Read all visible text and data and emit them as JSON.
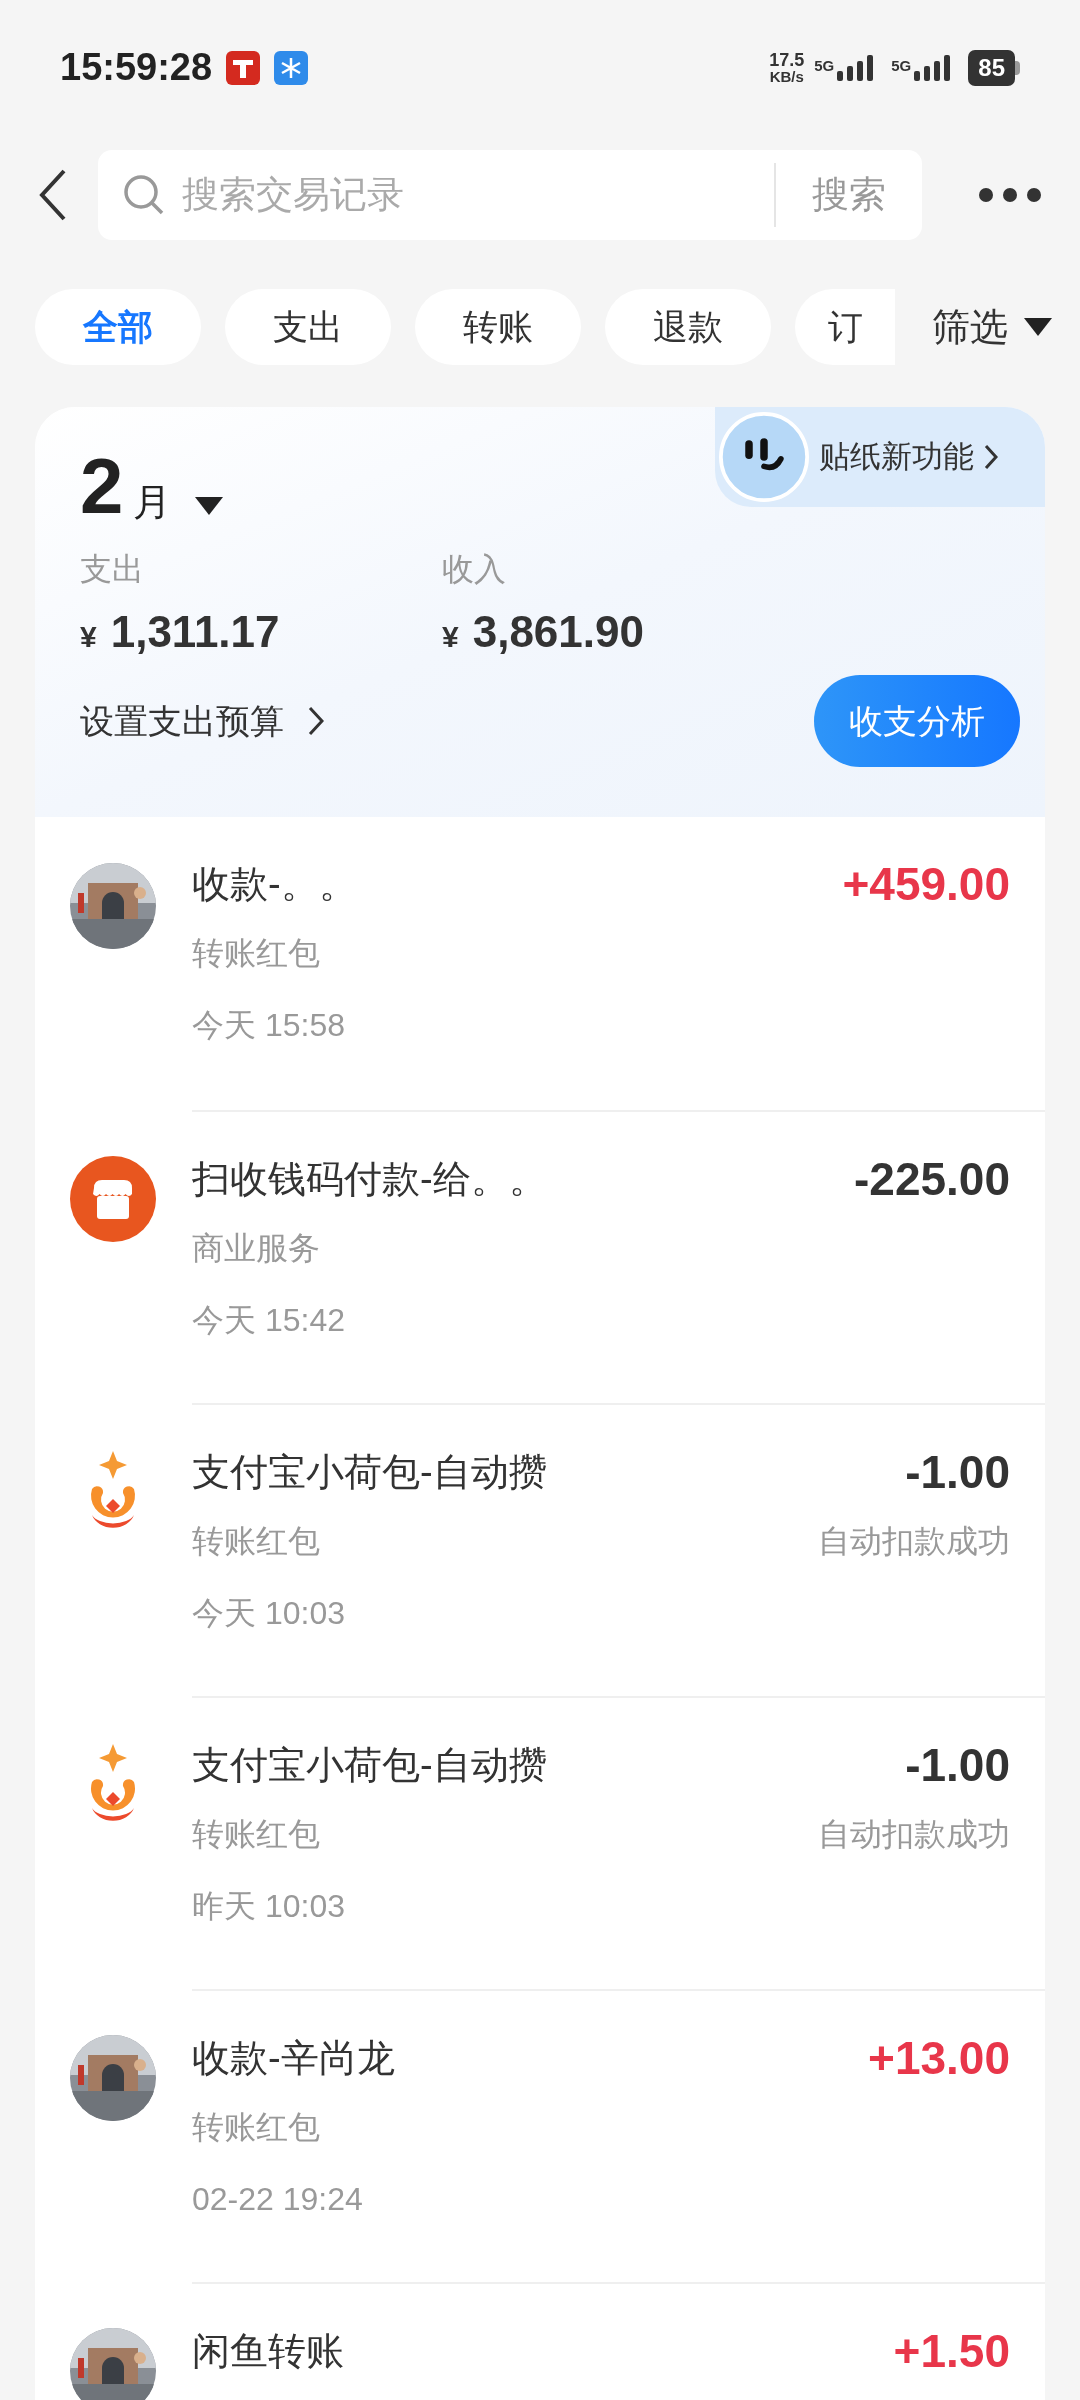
{
  "status_bar": {
    "time": "15:59:28",
    "speed": "17.5",
    "speed_unit": "KB/s",
    "networks": [
      "5G",
      "5G"
    ],
    "battery": "85"
  },
  "search": {
    "placeholder": "搜索交易记录",
    "button": "搜索"
  },
  "tabs": [
    {
      "label": "全部",
      "selected": true
    },
    {
      "label": "支出",
      "selected": false
    },
    {
      "label": "转账",
      "selected": false
    },
    {
      "label": "退款",
      "selected": false
    },
    {
      "label": "订",
      "selected": false
    }
  ],
  "filter": "筛选",
  "summary": {
    "month": "2",
    "month_unit": "月",
    "banner": "贴纸新功能",
    "expense_label": "支出",
    "expense": "1,311.17",
    "income_label": "收入",
    "income": "3,861.90",
    "currency": "¥",
    "budget_link": "设置支出预算",
    "analysis_button": "收支分析"
  },
  "transactions": [
    {
      "title": "收款-。。",
      "category": "转账红包",
      "time": "今天 15:58",
      "amount": "+459.00",
      "income": true
    },
    {
      "kind": "shop",
      "title": "扫收钱码付款-给。。",
      "category": "商业服务",
      "time": "今天 15:42",
      "amount": "-225.00",
      "income": false
    },
    {
      "kind": "pocket",
      "title": "支付宝小荷包-自动攒",
      "category": "转账红包",
      "time": "今天 10:03",
      "amount": "-1.00",
      "income": false,
      "status": "自动扣款成功"
    },
    {
      "kind": "pocket",
      "title": "支付宝小荷包-自动攒",
      "category": "转账红包",
      "time": "昨天 10:03",
      "amount": "-1.00",
      "income": false,
      "status": "自动扣款成功"
    },
    {
      "title": "收款-辛尚龙",
      "category": "转账红包",
      "time": "02-22 19:24",
      "amount": "+13.00",
      "income": true
    },
    {
      "title": "闲鱼转账",
      "amount": "+1.50",
      "income": true
    }
  ]
}
